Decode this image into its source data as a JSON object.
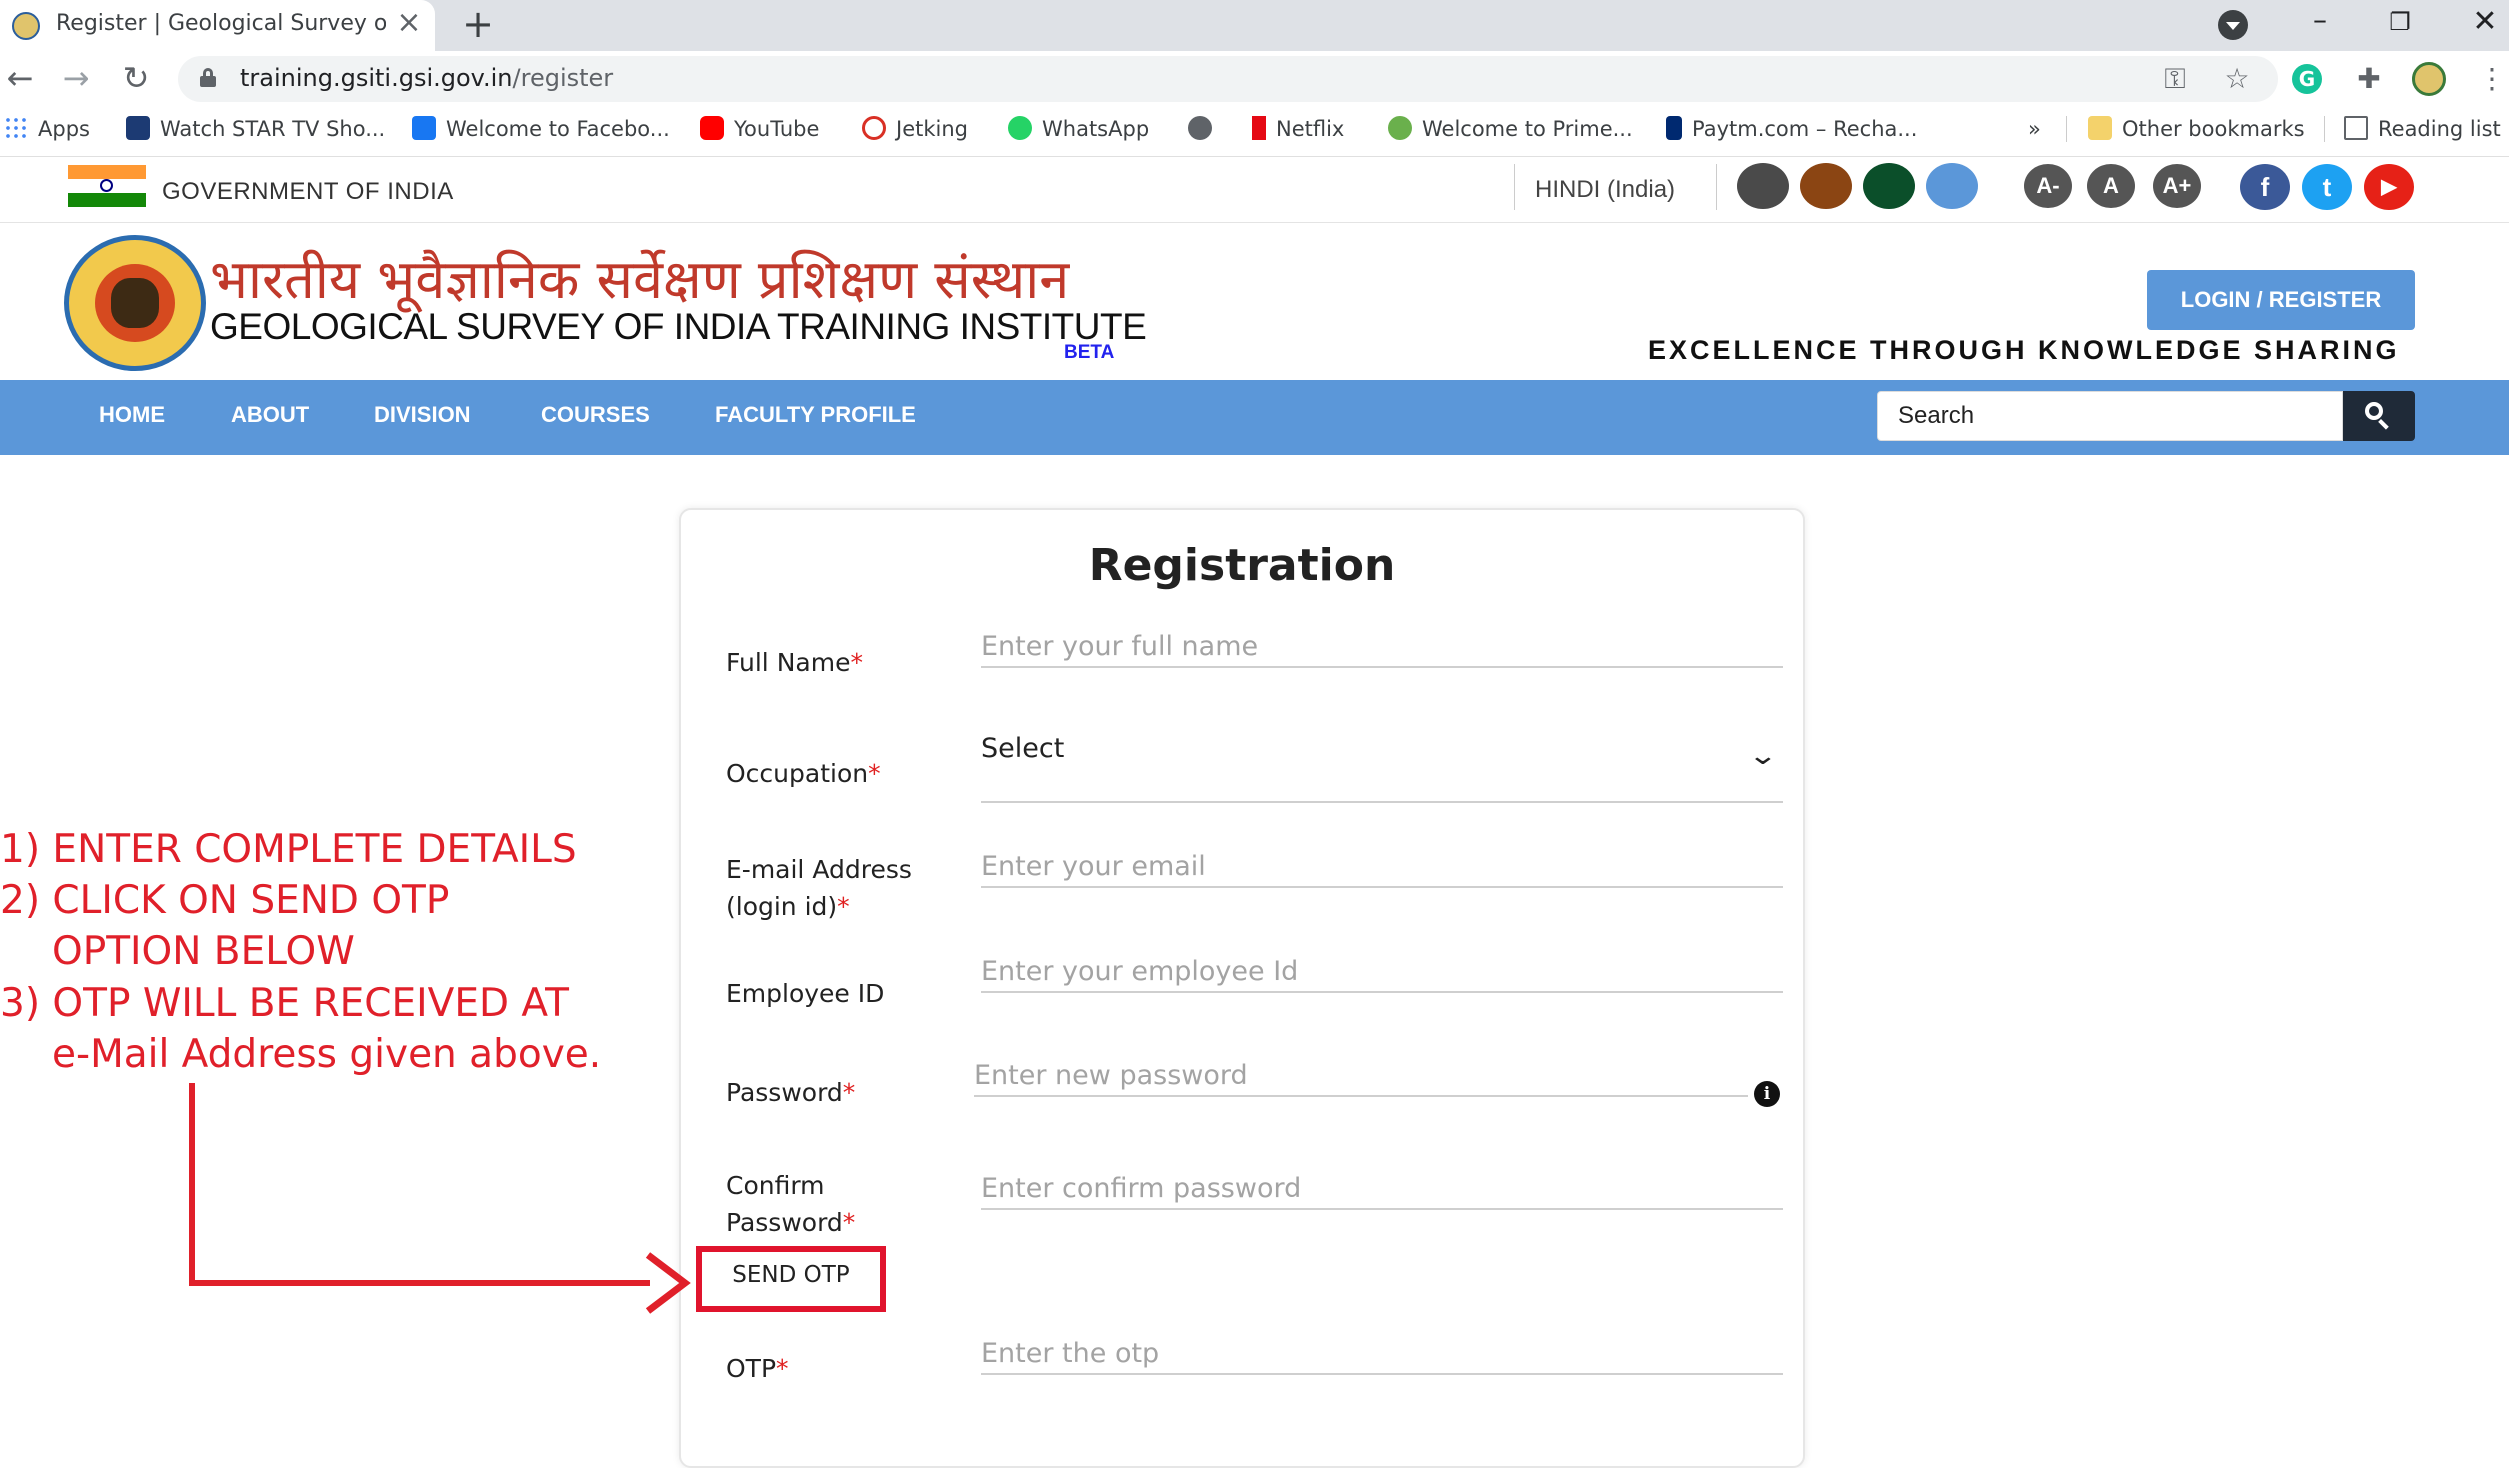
{
  "browser": {
    "tab_title": "Register | Geological Survey of India Training Institute",
    "url_host": "training.gsiti.gsi.gov.in",
    "url_path": "/register",
    "bookmarks": [
      {
        "label": "Apps",
        "color": "#4285f4"
      },
      {
        "label": "Watch STAR TV Sho...",
        "color": "#1c3a73"
      },
      {
        "label": "Welcome to Facebo...",
        "color": "#1877f2"
      },
      {
        "label": "YouTube",
        "color": "#ff0000"
      },
      {
        "label": "Jetking",
        "color": "#d93025"
      },
      {
        "label": "WhatsApp",
        "color": "#25d366"
      },
      {
        "label": "",
        "color": "#5f6368"
      },
      {
        "label": "Netflix",
        "color": "#e50914"
      },
      {
        "label": "Welcome to Prime...",
        "color": "#6ab04c"
      },
      {
        "label": "Paytm.com – Recha...",
        "color": "#002970"
      }
    ],
    "overflow": "»",
    "other_bookmarks": "Other bookmarks",
    "reading_list": "Reading list"
  },
  "gov_bar": {
    "label": "GOVERNMENT OF INDIA",
    "language": "HINDI (India)",
    "theme_colors": [
      "#4a4a4a",
      "#8b4513",
      "#0b4f2a",
      "#5b97d9"
    ],
    "font_sizes": [
      "A-",
      "A",
      "A+"
    ],
    "social": [
      {
        "name": "facebook",
        "glyph": "f",
        "color": "#3b5998"
      },
      {
        "name": "twitter",
        "glyph": "t",
        "color": "#1da1f2"
      },
      {
        "name": "youtube",
        "glyph": "▶",
        "color": "#e62117"
      }
    ]
  },
  "header": {
    "hindi_name": "भारतीय भूवैज्ञानिक सर्वेक्षण प्रशिक्षण संस्थान",
    "english_name": "GEOLOGICAL SURVEY OF INDIA TRAINING INSTITUTE",
    "beta": "BETA",
    "login_button": "LOGIN / REGISTER",
    "tagline": "EXCELLENCE THROUGH KNOWLEDGE SHARING"
  },
  "nav": {
    "items": [
      "HOME",
      "ABOUT",
      "DIVISION",
      "COURSES",
      "FACULTY PROFILE"
    ],
    "search_placeholder": "Search"
  },
  "form": {
    "title": "Registration",
    "fields": {
      "full_name": {
        "label": "Full Name",
        "placeholder": "Enter your full name"
      },
      "occupation": {
        "label": "Occupation",
        "value": "Select"
      },
      "email": {
        "label_line1": "E-mail Address",
        "label_line2": "(login id)",
        "placeholder": "Enter your email"
      },
      "employee_id": {
        "label": "Employee ID",
        "placeholder": "Enter your employee Id"
      },
      "password": {
        "label": "Password",
        "placeholder": "Enter new password"
      },
      "confirm_password": {
        "label_line1": "Confirm",
        "label_line2": "Password",
        "placeholder": "Enter confirm password"
      },
      "otp": {
        "label": "OTP",
        "placeholder": "Enter the otp"
      }
    },
    "required_mark": "*",
    "send_otp": "SEND OTP"
  },
  "annotation": {
    "lines": [
      "1) ENTER COMPLETE DETAILS",
      "2) CLICK ON SEND OTP",
      "OPTION BELOW",
      "3) OTP WILL BE RECEIVED AT",
      "e-Mail Address given above."
    ],
    "color": "#e0202a"
  }
}
